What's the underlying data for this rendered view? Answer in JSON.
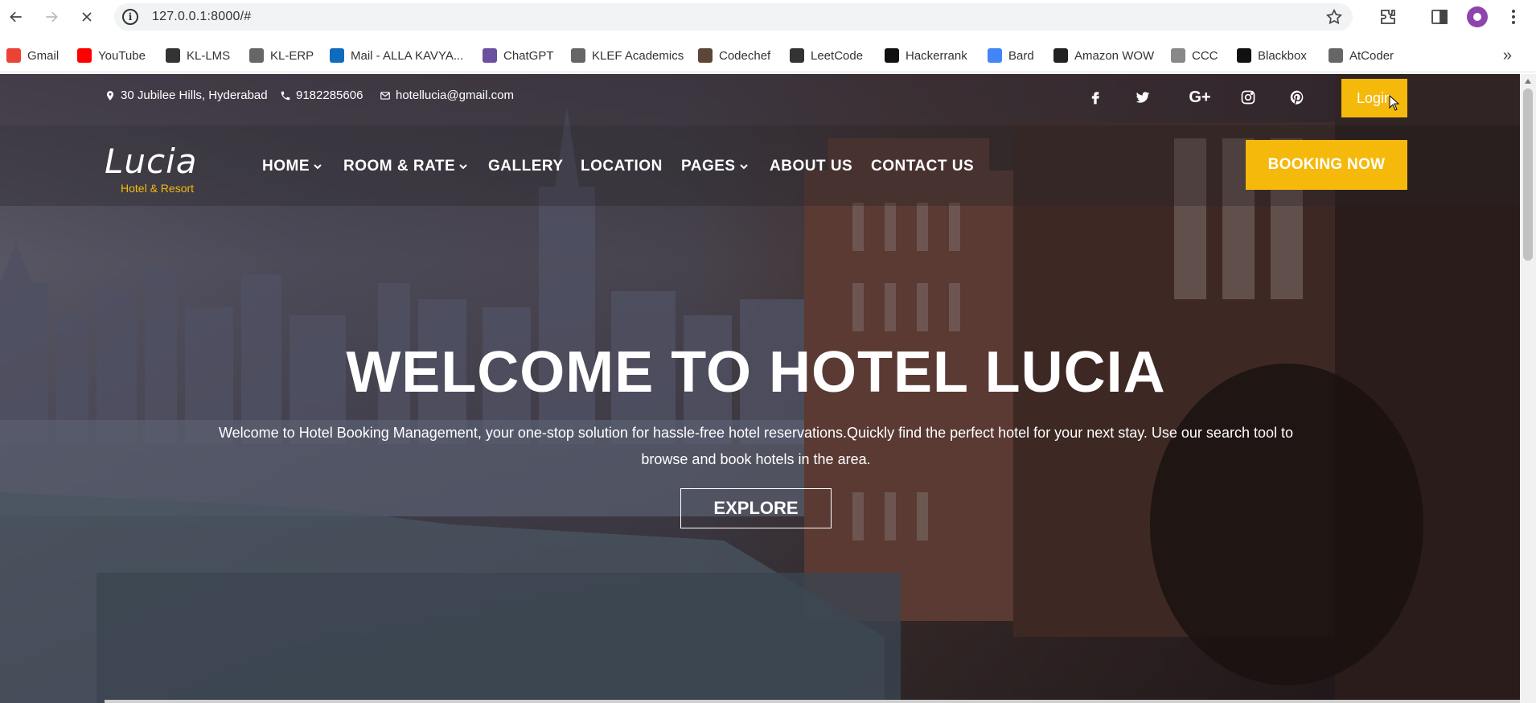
{
  "browser": {
    "url": "127.0.0.1:8000/#",
    "bookmarks": [
      {
        "label": "Gmail",
        "icon": "gmail-icon",
        "color": "#ea4335"
      },
      {
        "label": "YouTube",
        "icon": "youtube-icon",
        "color": "#ff0000"
      },
      {
        "label": "KL-LMS",
        "icon": "moodle-icon",
        "color": "#333333"
      },
      {
        "label": "KL-ERP",
        "icon": "gear-icon",
        "color": "#666666"
      },
      {
        "label": "Mail - ALLA KAVYA...",
        "icon": "outlook-icon",
        "color": "#0f6cbd"
      },
      {
        "label": "ChatGPT",
        "icon": "chatgpt-icon",
        "color": "#6b4fa0"
      },
      {
        "label": "KLEF Academics",
        "icon": "gear-icon",
        "color": "#666666"
      },
      {
        "label": "Codechef",
        "icon": "codechef-icon",
        "color": "#5b4638"
      },
      {
        "label": "LeetCode",
        "icon": "leetcode-icon",
        "color": "#333333"
      },
      {
        "label": "Hackerrank",
        "icon": "hackerrank-icon",
        "color": "#111111"
      },
      {
        "label": "Bard",
        "icon": "bard-icon",
        "color": "#4285f4"
      },
      {
        "label": "Amazon WOW",
        "icon": "amazon-icon",
        "color": "#222222"
      },
      {
        "label": "CCC",
        "icon": "ccc-icon",
        "color": "#888888"
      },
      {
        "label": "Blackbox",
        "icon": "blackbox-icon",
        "color": "#111111"
      },
      {
        "label": "AtCoder",
        "icon": "atcoder-icon",
        "color": "#666666"
      }
    ]
  },
  "site": {
    "topbar": {
      "address": "30 Jubilee Hills, Hyderabad",
      "phone": "9182285606",
      "email": "hotellucia@gmail.com",
      "login_label": "Login"
    },
    "logo": {
      "name": "Lucia",
      "subtitle": "Hotel & Resort"
    },
    "menu": [
      {
        "label": "HOME",
        "dropdown": true
      },
      {
        "label": "ROOM & RATE",
        "dropdown": true
      },
      {
        "label": "GALLERY",
        "dropdown": false
      },
      {
        "label": "LOCATION",
        "dropdown": false
      },
      {
        "label": "PAGES",
        "dropdown": true
      },
      {
        "label": "ABOUT US",
        "dropdown": false
      },
      {
        "label": "CONTACT US",
        "dropdown": false
      }
    ],
    "booking_label": "BOOKING NOW",
    "hero": {
      "title": "WELCOME TO HOTEL LUCIA",
      "text": "Welcome to Hotel Booking Management, your one-stop solution for hassle-free hotel reservations.Quickly find the perfect hotel for your next stay. Use our search tool to browse and book hotels in the area.",
      "button_label": "EXPLORE"
    },
    "accent_color": "#f5b90c"
  }
}
